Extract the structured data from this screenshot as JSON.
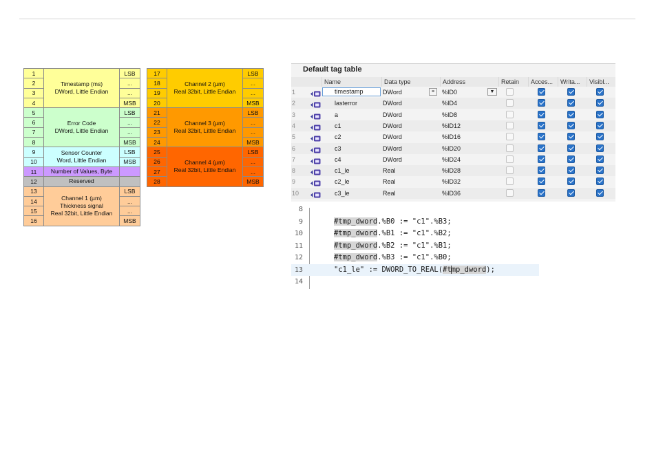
{
  "memory_map": {
    "left": [
      {
        "num": "1",
        "desc": "Timestamp (ms)\nDWord, Little Endian",
        "bit": "LSB",
        "bg": "#ffff99"
      },
      {
        "num": "2",
        "bit": "...",
        "bg": "#ffff99"
      },
      {
        "num": "3",
        "bit": "...",
        "bg": "#ffff99"
      },
      {
        "num": "4",
        "bit": "MSB",
        "bg": "#ffff99"
      },
      {
        "num": "5",
        "desc": "Error Code\nDWord, Little Endian",
        "bit": "LSB",
        "bg": "#ccffcc"
      },
      {
        "num": "6",
        "bit": "...",
        "bg": "#ccffcc"
      },
      {
        "num": "7",
        "bit": "...",
        "bg": "#ccffcc"
      },
      {
        "num": "8",
        "bit": "MSB",
        "bg": "#ccffcc"
      },
      {
        "num": "9",
        "desc": "Sensor Counter\nWord, Little Endian",
        "bit": "LSB",
        "bg": "#ccffff"
      },
      {
        "num": "10",
        "bit": "MSB",
        "bg": "#ccffff"
      },
      {
        "num": "11",
        "desc": "Number of Values, Byte",
        "bit": "",
        "bg": "#cc99ff"
      },
      {
        "num": "12",
        "desc": "Reserved",
        "bit": "",
        "bg": "#c0c0c0"
      },
      {
        "num": "13",
        "desc": "Channel 1 (µm)\nThickness signal\nReal 32bit, Little Endian",
        "bit": "LSB",
        "bg": "#ffcc99"
      },
      {
        "num": "14",
        "bit": "...",
        "bg": "#ffcc99"
      },
      {
        "num": "15",
        "bit": "...",
        "bg": "#ffcc99"
      },
      {
        "num": "16",
        "bit": "MSB",
        "bg": "#ffcc99"
      }
    ],
    "right": [
      {
        "num": "17",
        "desc": "Channel 2 (µm)\nReal 32bit, Little Endian",
        "bit": "LSB",
        "bg": "#ffcc00"
      },
      {
        "num": "18",
        "bit": "...",
        "bg": "#ffcc00"
      },
      {
        "num": "19",
        "bit": "...",
        "bg": "#ffcc00"
      },
      {
        "num": "20",
        "bit": "MSB",
        "bg": "#ffcc00"
      },
      {
        "num": "21",
        "desc": "Channel 3 (µm)\nReal 32bit, Little Endian",
        "bit": "LSB",
        "bg": "#ff9900"
      },
      {
        "num": "22",
        "bit": "...",
        "bg": "#ff9900"
      },
      {
        "num": "23",
        "bit": "...",
        "bg": "#ff9900"
      },
      {
        "num": "24",
        "bit": "MSB",
        "bg": "#ff9900"
      },
      {
        "num": "25",
        "desc": "Channel 4 (µm)\nReal 32bit, Little Endian",
        "bit": "LSB",
        "bg": "#ff6600"
      },
      {
        "num": "26",
        "bit": "...",
        "bg": "#ff6600"
      },
      {
        "num": "27",
        "bit": "...",
        "bg": "#ff6600"
      },
      {
        "num": "28",
        "bit": "MSB",
        "bg": "#ff6600"
      }
    ]
  },
  "tag_table": {
    "title": "Default tag table",
    "headers": {
      "name": "Name",
      "data_type": "Data type",
      "address": "Address",
      "retain": "Retain",
      "access": "Acces...",
      "write": "Writa...",
      "visible": "Visibl..."
    },
    "rows": [
      {
        "n": "1",
        "name": "timestamp",
        "type": "DWord",
        "addr": "%ID0",
        "retain": false,
        "access": true,
        "write": true,
        "visible": true
      },
      {
        "n": "2",
        "name": "lasterror",
        "type": "DWord",
        "addr": "%ID4",
        "retain": false,
        "access": true,
        "write": true,
        "visible": true
      },
      {
        "n": "3",
        "name": "a",
        "type": "DWord",
        "addr": "%ID8",
        "retain": false,
        "access": true,
        "write": true,
        "visible": true
      },
      {
        "n": "4",
        "name": "c1",
        "type": "DWord",
        "addr": "%ID12",
        "retain": false,
        "access": true,
        "write": true,
        "visible": true
      },
      {
        "n": "5",
        "name": "c2",
        "type": "DWord",
        "addr": "%ID16",
        "retain": false,
        "access": true,
        "write": true,
        "visible": true
      },
      {
        "n": "6",
        "name": "c3",
        "type": "DWord",
        "addr": "%ID20",
        "retain": false,
        "access": true,
        "write": true,
        "visible": true
      },
      {
        "n": "7",
        "name": "c4",
        "type": "DWord",
        "addr": "%ID24",
        "retain": false,
        "access": true,
        "write": true,
        "visible": true
      },
      {
        "n": "8",
        "name": "c1_le",
        "type": "Real",
        "addr": "%ID28",
        "retain": false,
        "access": true,
        "write": true,
        "visible": true
      },
      {
        "n": "9",
        "name": "c2_le",
        "type": "Real",
        "addr": "%ID32",
        "retain": false,
        "access": true,
        "write": true,
        "visible": true
      },
      {
        "n": "10",
        "name": "c3_le",
        "type": "Real",
        "addr": "%ID36",
        "retain": false,
        "access": true,
        "write": true,
        "visible": true
      }
    ]
  },
  "code": {
    "lines": [
      {
        "n": "8"
      },
      {
        "n": "9",
        "var": "#tmp_dword",
        "rest": ".%B0 := \"c1\".%B3;"
      },
      {
        "n": "10",
        "var": "#tmp_dword",
        "rest": ".%B1 := \"c1\".%B2;"
      },
      {
        "n": "11",
        "var": "#tmp_dword",
        "rest": ".%B2 := \"c1\".%B1;"
      },
      {
        "n": "12",
        "var": "#tmp_dword",
        "rest": ".%B3 := \"c1\".%B0;"
      },
      {
        "n": "13",
        "pre": "\"c1_le\" := DWORD_TO_REAL(",
        "arg_a": "#t",
        "arg_b": "mp_dword",
        "post": ");"
      },
      {
        "n": "14"
      }
    ]
  }
}
